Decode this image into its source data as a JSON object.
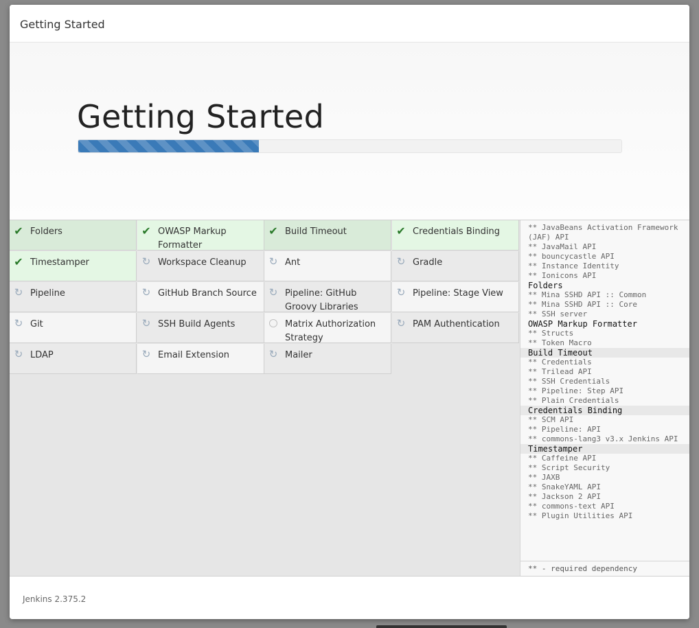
{
  "dialog": {
    "title": "Getting Started"
  },
  "hero": {
    "heading": "Getting Started",
    "progress": 0.333
  },
  "plugins": [
    {
      "name": "Folders",
      "status": "success"
    },
    {
      "name": "OWASP Markup Formatter",
      "status": "success"
    },
    {
      "name": "Build Timeout",
      "status": "success"
    },
    {
      "name": "Credentials Binding",
      "status": "success"
    },
    {
      "name": "Timestamper",
      "status": "success"
    },
    {
      "name": "Workspace Cleanup",
      "status": "installing"
    },
    {
      "name": "Ant",
      "status": "installing"
    },
    {
      "name": "Gradle",
      "status": "installing"
    },
    {
      "name": "Pipeline",
      "status": "installing"
    },
    {
      "name": "GitHub Branch Source",
      "status": "installing"
    },
    {
      "name": "Pipeline: GitHub Groovy Libraries",
      "status": "installing"
    },
    {
      "name": "Pipeline: Stage View",
      "status": "installing"
    },
    {
      "name": "Git",
      "status": "installing"
    },
    {
      "name": "SSH Build Agents",
      "status": "installing"
    },
    {
      "name": "Matrix Authorization Strategy",
      "status": "pending"
    },
    {
      "name": "PAM Authentication",
      "status": "installing"
    },
    {
      "name": "LDAP",
      "status": "installing"
    },
    {
      "name": "Email Extension",
      "status": "installing"
    },
    {
      "name": "Mailer",
      "status": "installing"
    }
  ],
  "deps": {
    "lines": [
      {
        "type": "dep",
        "text": "** JavaBeans Activation Framework (JAF) API"
      },
      {
        "type": "dep",
        "text": "** JavaMail API"
      },
      {
        "type": "dep",
        "text": "** bouncycastle API"
      },
      {
        "type": "dep",
        "text": "** Instance Identity"
      },
      {
        "type": "dep",
        "text": "** Ionicons API"
      },
      {
        "type": "head",
        "text": "Folders"
      },
      {
        "type": "dep",
        "text": "** Mina SSHD API :: Common"
      },
      {
        "type": "dep",
        "text": "** Mina SSHD API :: Core"
      },
      {
        "type": "dep",
        "text": "** SSH server"
      },
      {
        "type": "head",
        "text": "OWASP Markup Formatter"
      },
      {
        "type": "dep",
        "text": "** Structs"
      },
      {
        "type": "dep",
        "text": "** Token Macro"
      },
      {
        "type": "head",
        "text": "Build Timeout",
        "band": true
      },
      {
        "type": "dep",
        "text": "** Credentials"
      },
      {
        "type": "dep",
        "text": "** Trilead API"
      },
      {
        "type": "dep",
        "text": "** SSH Credentials"
      },
      {
        "type": "dep",
        "text": "** Pipeline: Step API"
      },
      {
        "type": "dep",
        "text": "** Plain Credentials"
      },
      {
        "type": "head",
        "text": "Credentials Binding",
        "band": true
      },
      {
        "type": "dep",
        "text": "** SCM API"
      },
      {
        "type": "dep",
        "text": "** Pipeline: API"
      },
      {
        "type": "dep",
        "text": "** commons-lang3 v3.x Jenkins API"
      },
      {
        "type": "head",
        "text": "Timestamper",
        "band": true
      },
      {
        "type": "dep",
        "text": "** Caffeine API"
      },
      {
        "type": "dep",
        "text": "** Script Security"
      },
      {
        "type": "dep",
        "text": "** JAXB"
      },
      {
        "type": "dep",
        "text": "** SnakeYAML API"
      },
      {
        "type": "dep",
        "text": "** Jackson 2 API"
      },
      {
        "type": "dep",
        "text": "** commons-text API"
      },
      {
        "type": "dep",
        "text": "** Plugin Utilities API"
      }
    ],
    "legend": "** - required dependency"
  },
  "footer": {
    "version": "Jenkins 2.375.2"
  }
}
